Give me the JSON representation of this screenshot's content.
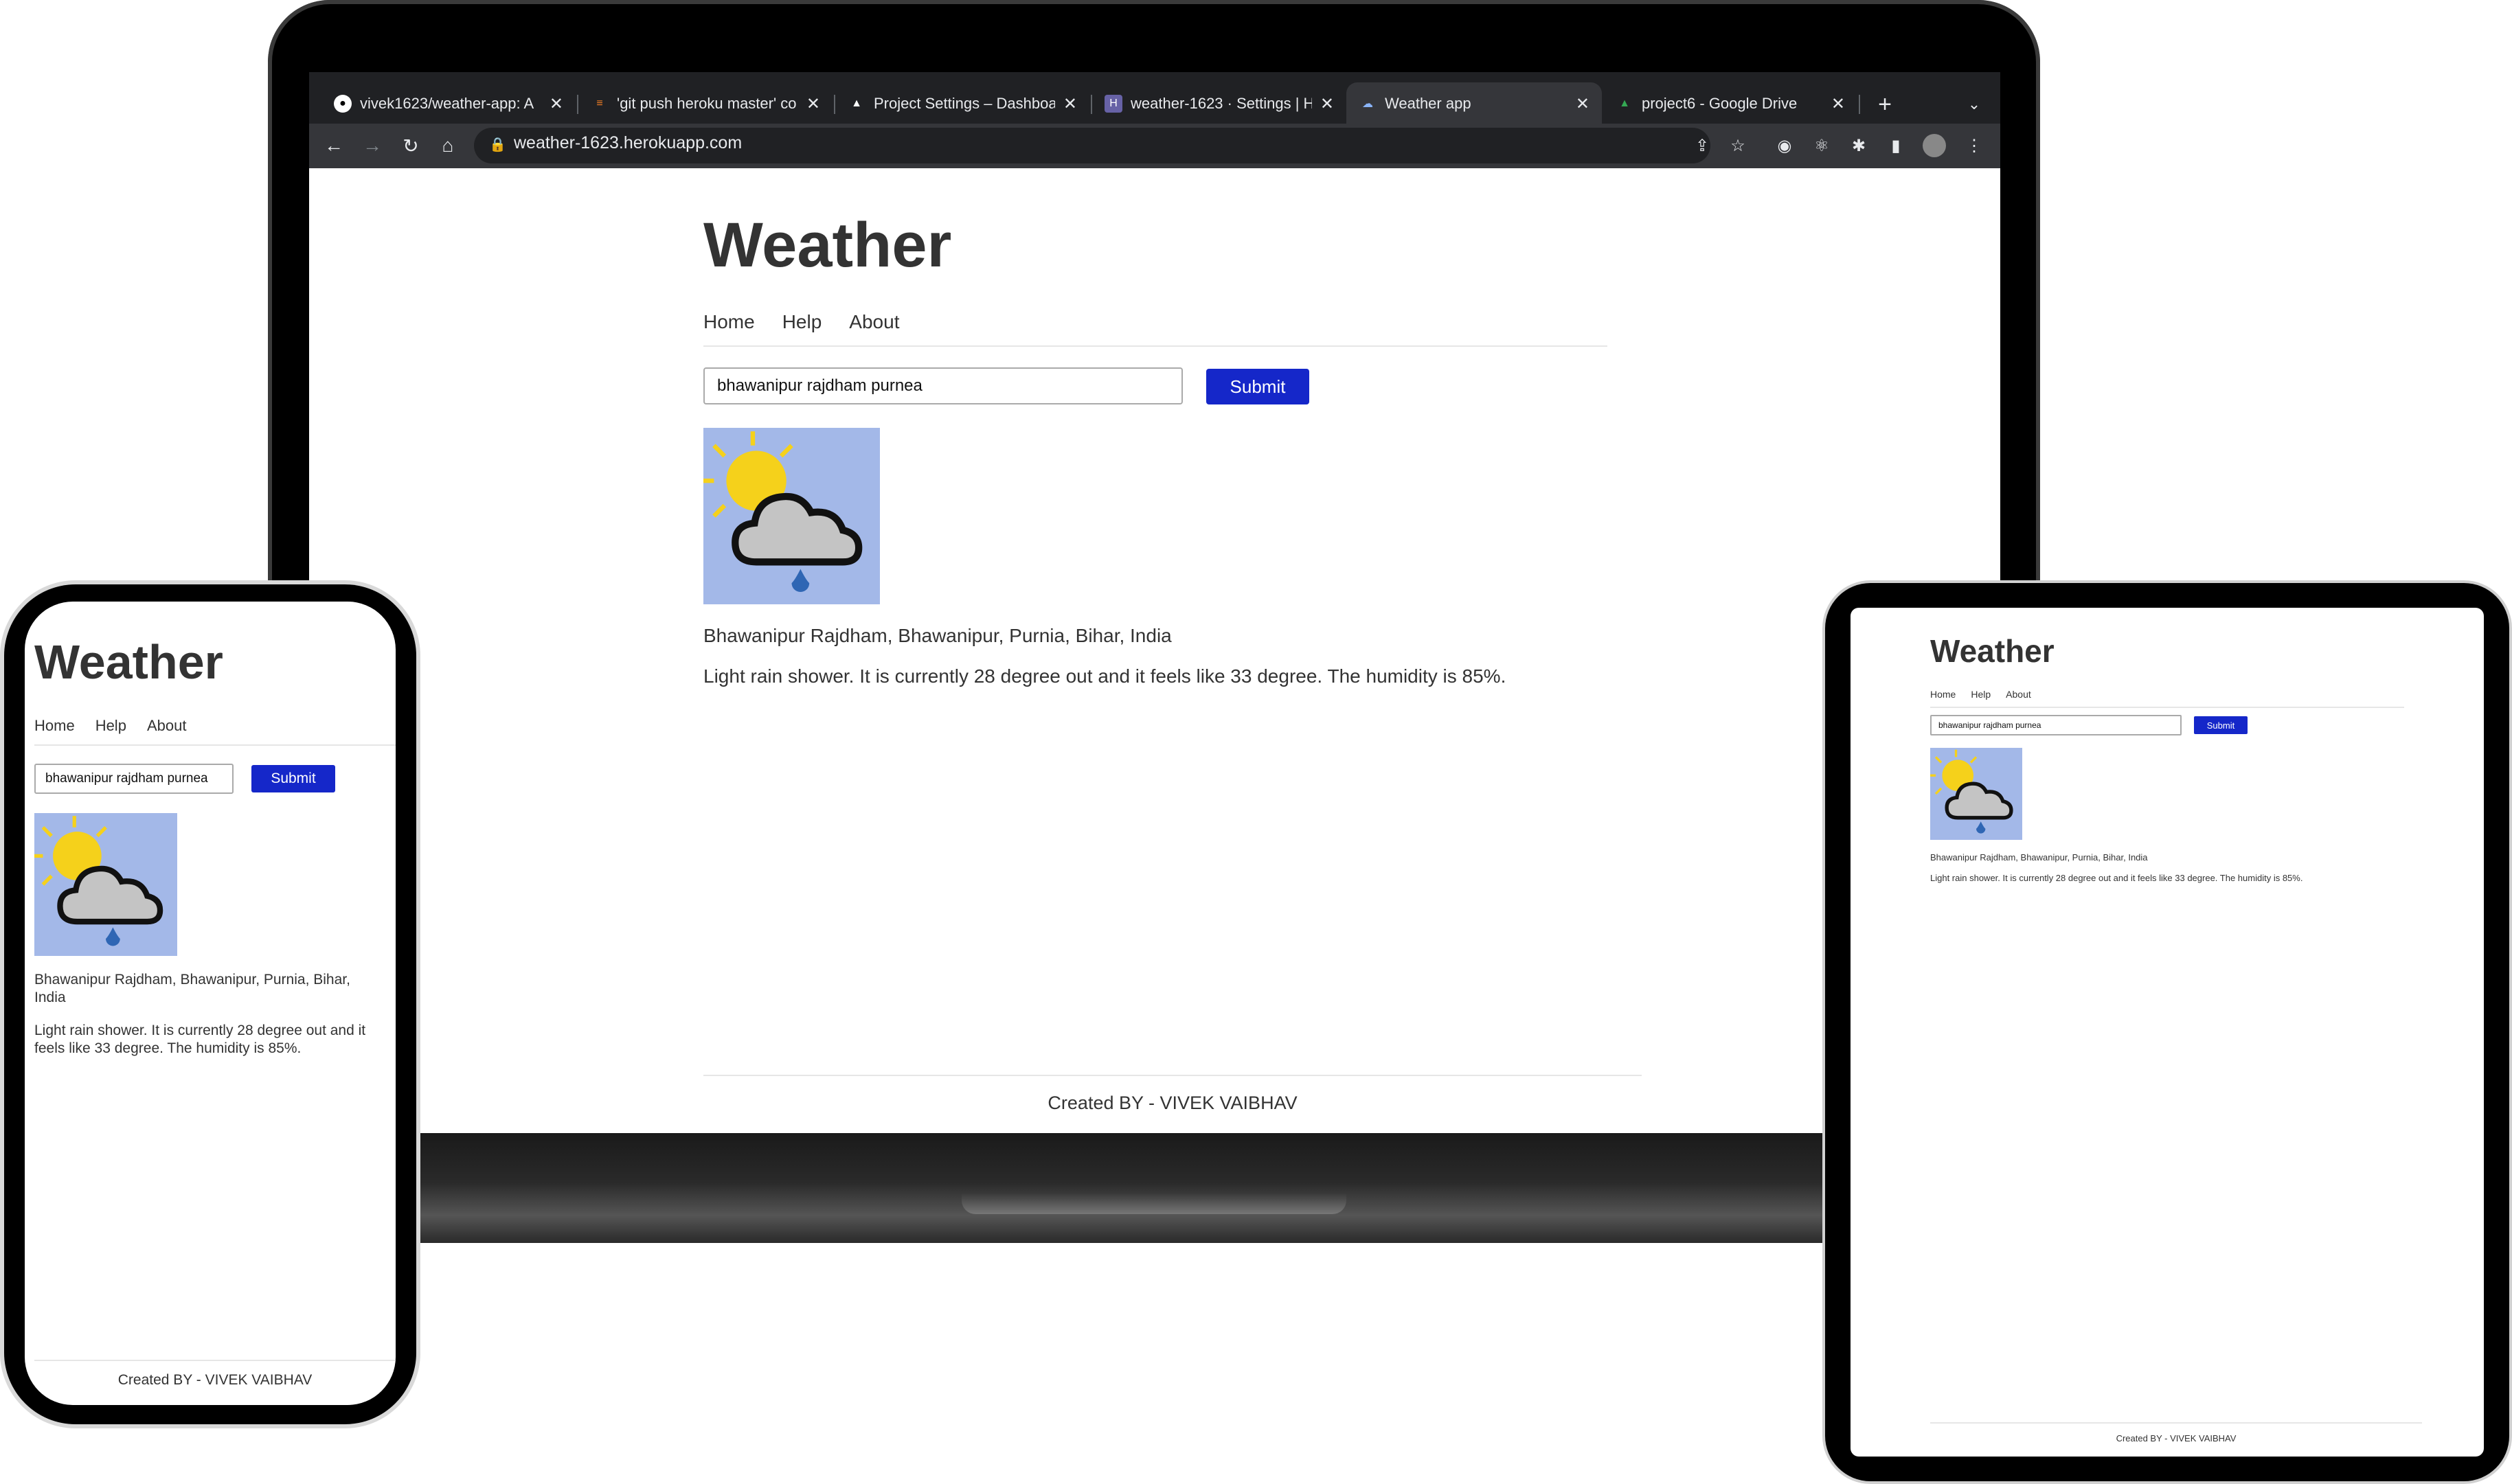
{
  "browser": {
    "tabs": [
      {
        "title": "vivek1623/weather-app: A",
        "favicon": "github-icon",
        "active": false
      },
      {
        "title": "'git push heroku master' co",
        "favicon": "stackoverflow-icon",
        "active": false
      },
      {
        "title": "Project Settings – Dashboa",
        "favicon": "vercel-icon",
        "active": false
      },
      {
        "title": "weather-1623 · Settings | H",
        "favicon": "heroku-icon",
        "active": false
      },
      {
        "title": "Weather app",
        "favicon": "weather-icon",
        "active": true
      },
      {
        "title": "project6 - Google Drive",
        "favicon": "google-drive-icon",
        "active": false
      }
    ],
    "url": "weather-1623.herokuapp.com"
  },
  "page": {
    "title": "Weather",
    "nav": [
      "Home",
      "Help",
      "About"
    ],
    "search_value": "bhawanipur rajdham purnea",
    "submit_label": "Submit",
    "location": "Bhawanipur Rajdham, Bhawanipur, Purnia, Bihar, India",
    "forecast": "Light rain shower. It is currently 28 degree out and it feels like 33 degree. The humidity is 85%.",
    "footer": "Created BY - VIVEK VAIBHAV",
    "weather_icon": "sun-cloud-rain-icon"
  },
  "colors": {
    "submit_bg": "#1527c9",
    "icon_bg": "#a3b8e8",
    "chrome_dark": "#202124",
    "chrome_toolbar": "#35363a"
  }
}
